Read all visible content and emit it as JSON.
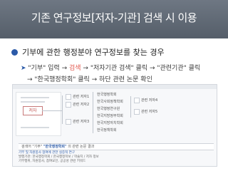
{
  "slide": {
    "title": "기존 연구정보[저자-기관] 검색 시 이용"
  },
  "content": {
    "heading": "기부에 관한 행정분야 연구정보를 찾는 경우",
    "step1_keyword": "\"기부\" 입력",
    "step1_arrow1": "→",
    "step1_search": "검색",
    "step1_arrow2": "→",
    "step1_rest": "\"저자기관 검색\" 클릭 → \"관련기관\" 클릭",
    "step2": "→ \"한국행정학회\" 클릭 → 하단 관련 논문 확인"
  },
  "screenshot": {
    "tree_root": "저자",
    "column1": [
      "관련 저자1",
      "관련 저자2",
      "관련 저자3"
    ],
    "column2": [
      "한국행정학회",
      "한국사회정책학회",
      "한국행정연구원",
      "한국지방정부학회",
      "한국지방자치학회",
      "한국정책학회"
    ],
    "column3": [
      "관련 저자4",
      "관련 저자5"
    ],
    "result_prefix": "검색어 \"기부\"",
    "result_org": "\"한국행정학회\"",
    "result_suffix": "의 관련 논문 결과",
    "result_title": "기부 및 자원봉사 참여에 관한 실증적 연구",
    "result_meta": "발행기관: 한국행정학회 / 한국행정학보 / 학술지 / 저자 정보",
    "result_snippet": "기부행위, 자원봉사, 참여요인, 공공성 관련 키워드"
  }
}
